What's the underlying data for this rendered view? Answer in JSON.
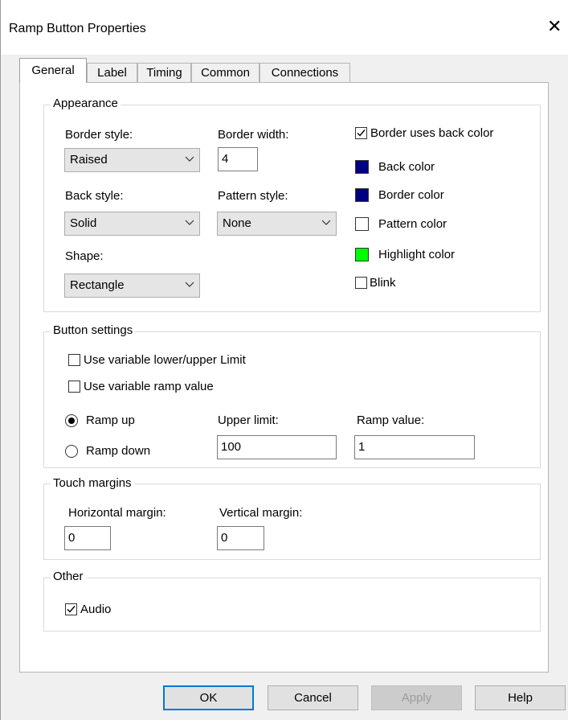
{
  "window": {
    "title": "Ramp Button Properties",
    "close_glyph": "✕"
  },
  "tabs": [
    {
      "label": "General",
      "active": true
    },
    {
      "label": "Label",
      "active": false
    },
    {
      "label": "Timing",
      "active": false
    },
    {
      "label": "Common",
      "active": false
    },
    {
      "label": "Connections",
      "active": false
    }
  ],
  "appearance": {
    "title": "Appearance",
    "border_style_label": "Border style:",
    "border_style_value": "Raised",
    "border_width_label": "Border width:",
    "border_width_value": "4",
    "back_style_label": "Back style:",
    "back_style_value": "Solid",
    "pattern_style_label": "Pattern style:",
    "pattern_style_value": "None",
    "shape_label": "Shape:",
    "shape_value": "Rectangle",
    "border_uses_back_color": {
      "label": "Border uses back color",
      "checked": true
    },
    "colors": [
      {
        "label": "Back color",
        "color": "#000080"
      },
      {
        "label": "Border color",
        "color": "#000080"
      },
      {
        "label": "Pattern color",
        "color": "#ffffff"
      },
      {
        "label": "Highlight color",
        "color": "#00ff00"
      }
    ],
    "blink": {
      "label": "Blink",
      "checked": false
    }
  },
  "button_settings": {
    "title": "Button settings",
    "variable_limit": {
      "label": "Use variable lower/upper Limit",
      "checked": false
    },
    "variable_ramp": {
      "label": "Use variable ramp value",
      "checked": false
    },
    "ramp_up": {
      "label": "Ramp up",
      "selected": true
    },
    "ramp_down": {
      "label": "Ramp down",
      "selected": false
    },
    "upper_limit_label": "Upper limit:",
    "upper_limit_value": "100",
    "ramp_value_label": "Ramp value:",
    "ramp_value_value": "1"
  },
  "touch_margins": {
    "title": "Touch margins",
    "horizontal_label": "Horizontal  margin:",
    "horizontal_value": "0",
    "vertical_label": "Vertical margin:",
    "vertical_value": "0"
  },
  "other": {
    "title": "Other",
    "audio": {
      "label": "Audio",
      "checked": true
    }
  },
  "buttons": {
    "ok": "OK",
    "cancel": "Cancel",
    "apply": "Apply",
    "help": "Help"
  }
}
